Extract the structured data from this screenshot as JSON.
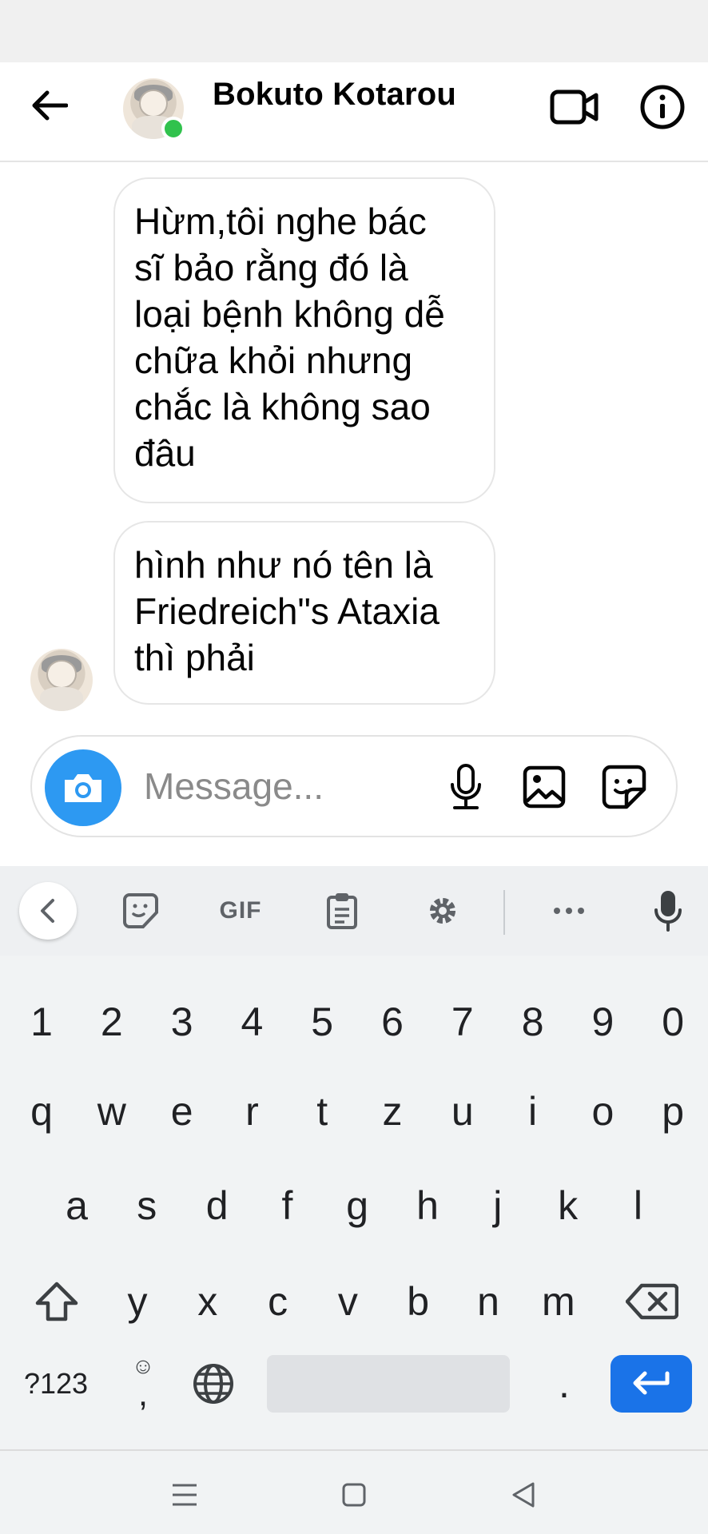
{
  "header": {
    "contact_name": "Bokuto Kotarou",
    "online": true
  },
  "messages": [
    {
      "text": "Hừm,tôi nghe bác\nsĩ bảo rằng đó là\nloại bệnh không dễ\nchữa khỏi nhưng\nchắc là không sao\nđâu"
    },
    {
      "text": "hình như nó tên là\nFriedreich\"s Ataxia\nthì phải"
    }
  ],
  "composer": {
    "placeholder": "Message..."
  },
  "keyboard": {
    "toolbar": {
      "gif_label": "GIF"
    },
    "rows": [
      [
        "1",
        "2",
        "3",
        "4",
        "5",
        "6",
        "7",
        "8",
        "9",
        "0"
      ],
      [
        "q",
        "w",
        "e",
        "r",
        "t",
        "z",
        "u",
        "i",
        "o",
        "p"
      ],
      [
        "a",
        "s",
        "d",
        "f",
        "g",
        "h",
        "j",
        "k",
        "l"
      ],
      [
        "y",
        "x",
        "c",
        "v",
        "b",
        "n",
        "m"
      ]
    ],
    "symbols_key": "?123",
    "comma_key": ",",
    "emoji_hint": "☺",
    "period_key": "."
  },
  "colors": {
    "accent_blue": "#2d99f2",
    "online_green": "#31c24d",
    "enter_blue": "#1a73e8"
  },
  "icons": [
    "back-arrow-icon",
    "video-call-icon",
    "info-icon",
    "camera-icon",
    "microphone-icon",
    "image-icon",
    "sticker-icon",
    "chevron-left-icon",
    "gif-icon",
    "clipboard-icon",
    "settings-gear-icon",
    "more-dots-icon",
    "voice-input-icon",
    "shift-icon",
    "backspace-icon",
    "globe-icon",
    "enter-icon",
    "recent-apps-icon",
    "home-icon",
    "back-nav-icon"
  ]
}
